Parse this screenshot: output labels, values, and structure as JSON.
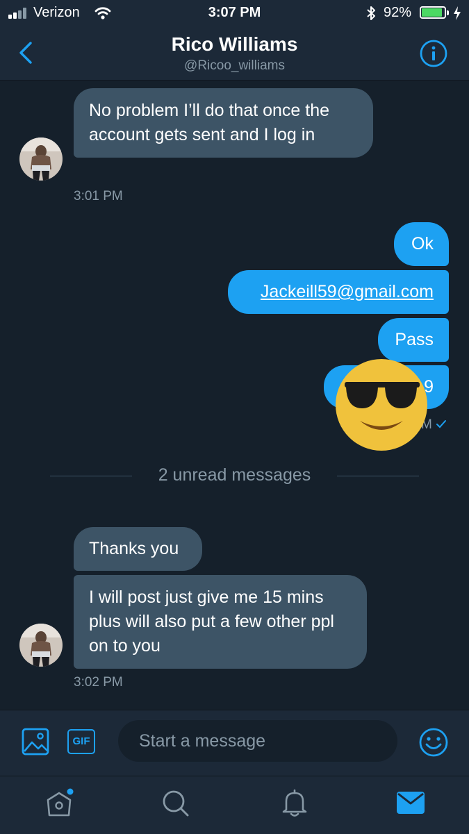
{
  "status_bar": {
    "carrier": "Verizon",
    "time": "3:07 PM",
    "battery": "92%",
    "battery_level": 0.92
  },
  "header": {
    "name": "Rico Williams",
    "handle": "@Ricoo_williams"
  },
  "messages": {
    "first_in": {
      "text": "No problem I’ll do that once the account gets sent and I log in",
      "time": "3:01 PM"
    },
    "out": [
      {
        "text": "Ok"
      },
      {
        "text": "Jackeill59@gmail.com"
      },
      {
        "text": "Pass"
      },
      {
        "text": "9"
      }
    ],
    "out_time_partial": "M",
    "unread_divider": "2 unread messages",
    "second_in": [
      {
        "text": "Thanks you"
      },
      {
        "text": "I will post just give me 15 mins plus will also put a few other ppl on to you"
      }
    ],
    "second_time": "3:02 PM"
  },
  "composer": {
    "placeholder": "Start a message",
    "gif_label": "GIF"
  },
  "colors": {
    "accent": "#1da1f2",
    "background": "#15202b",
    "bar": "#1c2938",
    "incoming_bubble": "#3d5466",
    "muted_text": "#8899a6",
    "emoji": "#f0c23c"
  },
  "icons": [
    "back-chevron-icon",
    "info-icon",
    "image-icon",
    "gif-icon",
    "emoji-icon",
    "home-icon",
    "search-icon",
    "bell-icon",
    "mail-icon",
    "sunglasses-emoji-icon"
  ]
}
